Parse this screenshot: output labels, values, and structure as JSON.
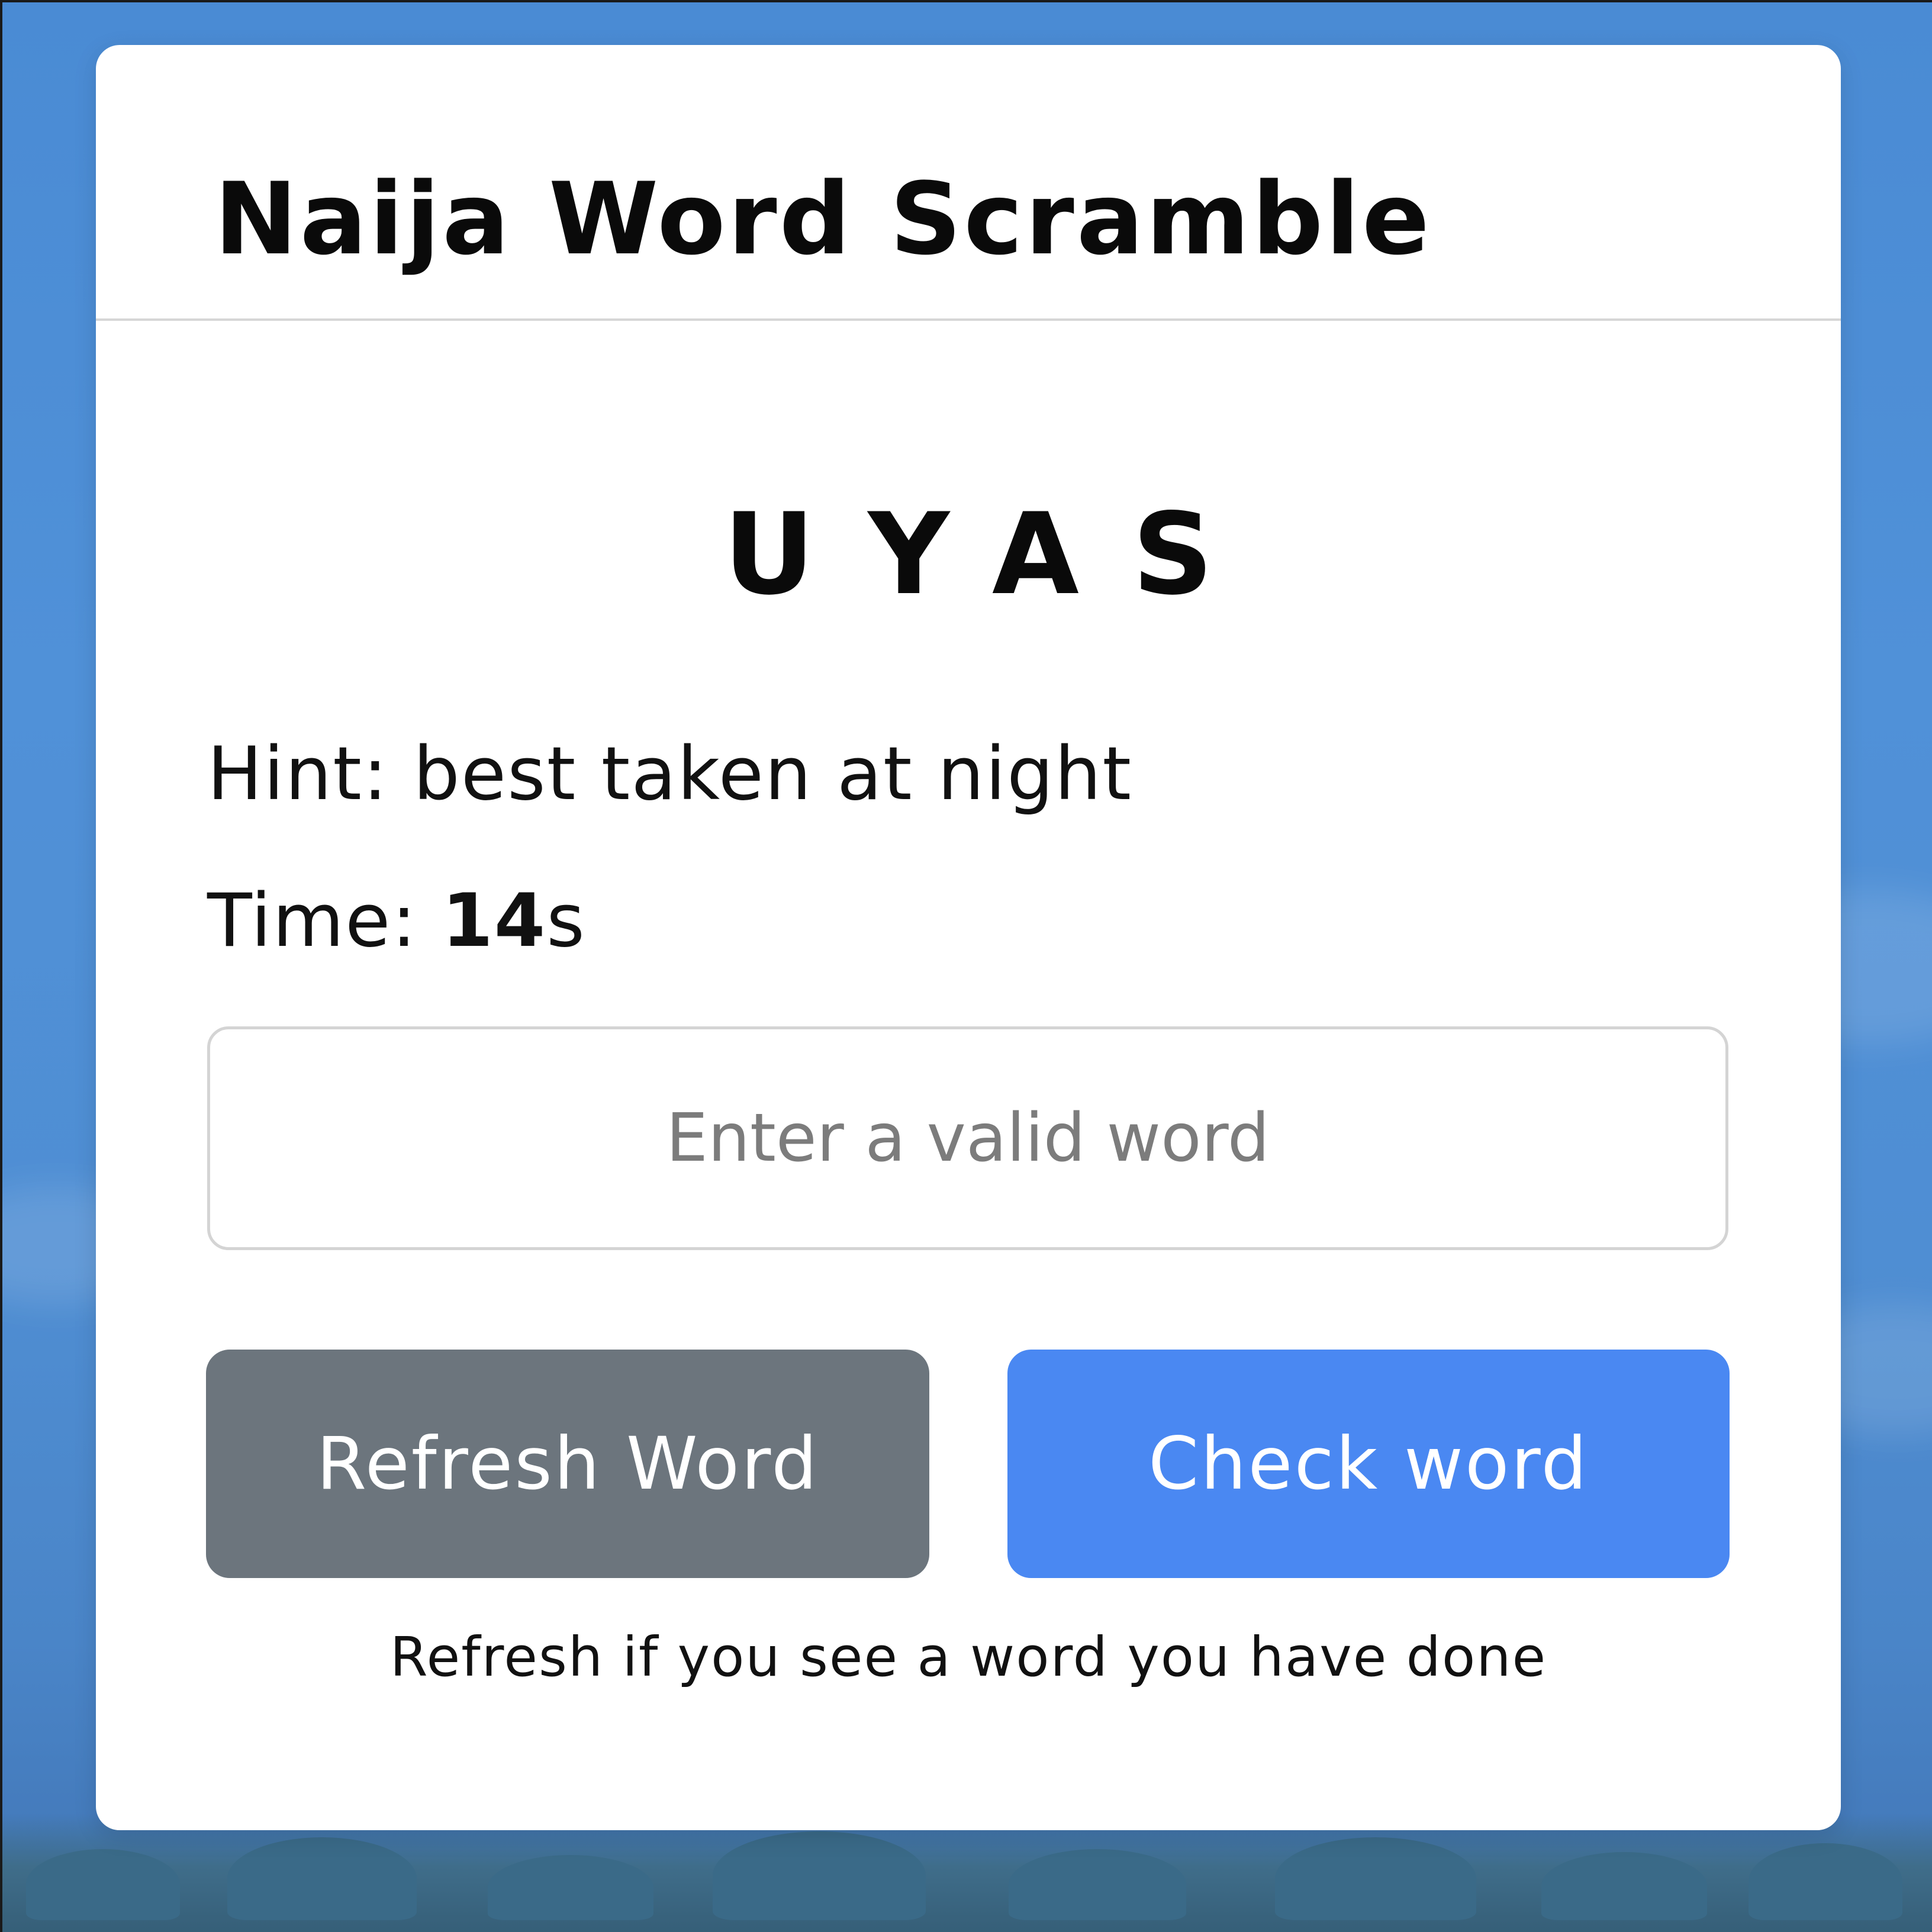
{
  "app": {
    "title": "Naija Word Scramble"
  },
  "game": {
    "scrambled_word": "UYAS",
    "hint_label": "Hint: ",
    "hint_text": "best taken at night",
    "time_label": "Time: ",
    "time_value": "14",
    "time_unit": "s"
  },
  "input": {
    "placeholder": "Enter a valid word",
    "value": ""
  },
  "buttons": {
    "refresh_label": "Refresh Word",
    "check_label": "Check word"
  },
  "note": "Refresh if you see a word you have done",
  "colors": {
    "background": "#4f8fd6",
    "card": "#ffffff",
    "refresh_button": "#6c757d",
    "check_button": "#4a88f2"
  }
}
